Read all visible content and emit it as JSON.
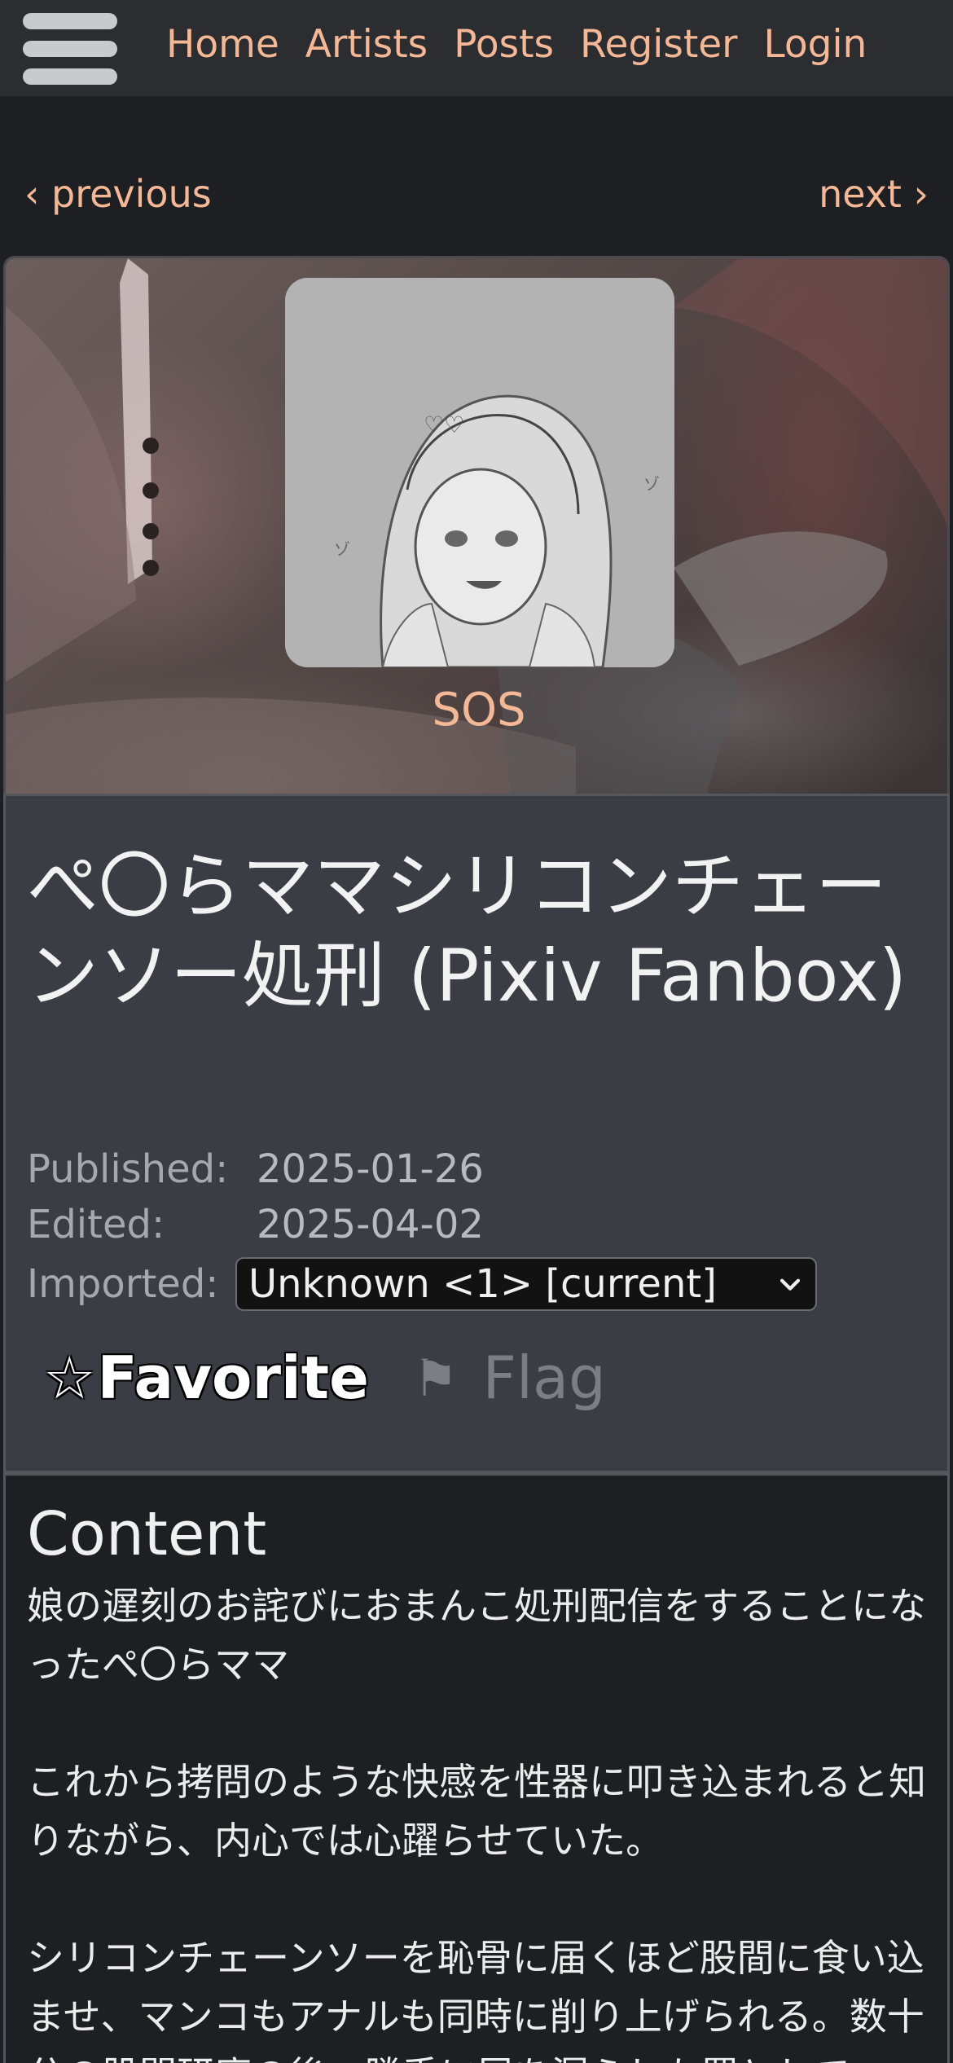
{
  "nav": {
    "links": [
      "Home",
      "Artists",
      "Posts",
      "Register",
      "Login"
    ]
  },
  "pager": {
    "previous": "‹ previous",
    "next": "next ›"
  },
  "artist": {
    "name": "SOS"
  },
  "post": {
    "title": "ぺ〇らママシリコンチェーンソー処刑 (Pixiv Fanbox)",
    "published_label": "Published:",
    "published": "2025-01-26",
    "edited_label": "Edited:",
    "edited": "2025-04-02",
    "imported_label": "Imported:",
    "imported_selected": "Unknown <1> [current]",
    "favorite_label": "Favorite",
    "flag_label": "Flag"
  },
  "content": {
    "heading": "Content",
    "paragraphs": [
      "娘の遅刻のお詫びにおまんこ処刑配信をすることになったぺ〇らママ",
      "これから拷問のような快感を性器に叩き込まれると知りながら、内心では心躍らせていた。",
      "シリコンチェーンソーを恥骨に届くほど股間に食い込ませ、マンコもアナルも同時に削り上げられる。数十分の股間研磨の後、勝手に尿を漏らした罰として"
    ]
  },
  "colors": {
    "link": "#f4b896",
    "nav_bg": "#2c2d31",
    "page_bg": "#1e1f22",
    "card_bg": "#3a3d44"
  },
  "icons": {
    "menu": "hamburger-icon",
    "favorite": "star-outline-icon",
    "flag": "flag-icon",
    "select": "chevron-down-icon"
  }
}
